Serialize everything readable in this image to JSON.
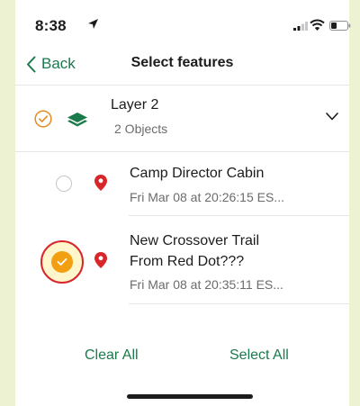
{
  "status_bar": {
    "time": "8:38"
  },
  "nav": {
    "back_label": "Back",
    "title": "Select features"
  },
  "layer": {
    "name": "Layer 2",
    "count": "2 Objects"
  },
  "features": [
    {
      "title_lines": [
        "Camp Director Cabin"
      ],
      "date": "Fri Mar 08 at 20:26:15 ES...",
      "selected": false
    },
    {
      "title_lines": [
        "New Crossover Trail",
        "From Red Dot???"
      ],
      "date": "Fri Mar 08 at 20:35:11 ES...",
      "selected": true
    }
  ],
  "footer": {
    "clear_all": "Clear All",
    "select_all": "Select All"
  },
  "colors": {
    "accent_green": "#1a7a4c",
    "check_orange": "#e58a1f",
    "pin_red": "#d8262b",
    "highlight_ring": "#d8262b",
    "page_bg": "#ecf2d2"
  },
  "icons": [
    "location-arrow-icon",
    "signal-icon",
    "wifi-icon",
    "battery-icon",
    "chevron-left-icon",
    "check-circle-icon",
    "layers-icon",
    "chevron-down-icon",
    "map-pin-icon"
  ]
}
